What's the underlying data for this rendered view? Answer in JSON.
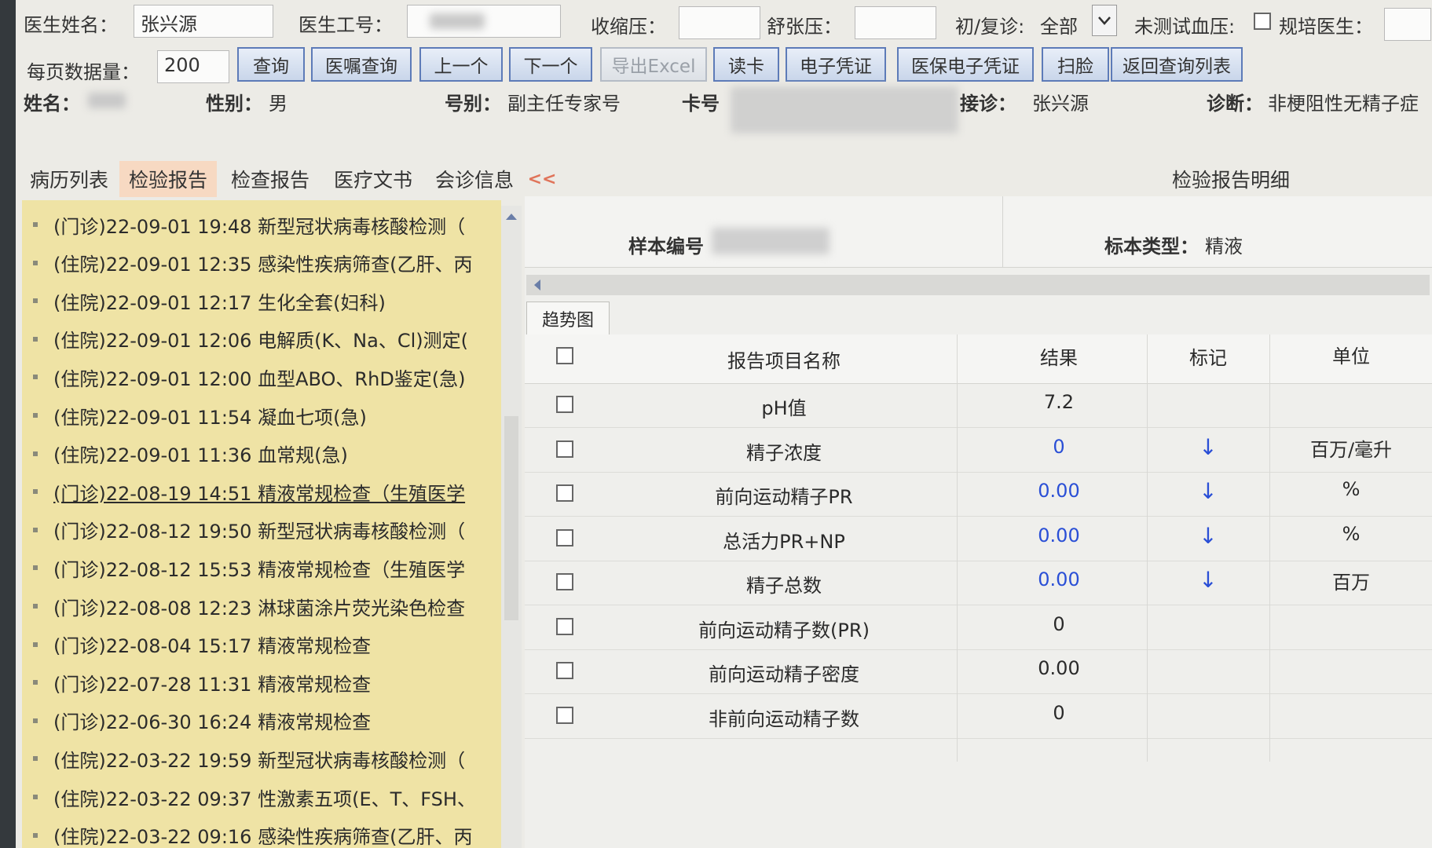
{
  "filters": {
    "doctor_name_label": "医生姓名：",
    "doctor_name_value": "张兴源",
    "doctor_id_label": "医生工号：",
    "systolic_label": "收缩压：",
    "diastolic_label": "舒张压：",
    "visit_type_label": "初/复诊:",
    "visit_type_value": "全部",
    "untested_bp_label": "未测试血压:",
    "resident_doctor_label": "规培医生：",
    "page_size_label": "每页数据量：",
    "page_size_value": "200"
  },
  "toolbar": {
    "query": "查询",
    "order_query": "医嘱查询",
    "prev": "上一个",
    "next": "下一个",
    "export_excel": "导出Excel",
    "read_card": "读卡",
    "e_voucher": "电子凭证",
    "insurance_e_voucher": "医保电子凭证",
    "scan": "扫脸",
    "back_to_list": "返回查询列表"
  },
  "patient": {
    "name_label": "姓名：",
    "gender_label": "性别：",
    "gender_value": "男",
    "reg_type_label": "号别：",
    "reg_type_value": "副主任专家号",
    "card_label": "卡号",
    "doctor_label": "接诊：",
    "doctor_value": "张兴源",
    "diagnosis_label": "诊断：",
    "diagnosis_value": "非梗阻性无精子症"
  },
  "tabs": [
    {
      "label": "病历列表"
    },
    {
      "label": "检验报告"
    },
    {
      "label": "检查报告"
    },
    {
      "label": "医疗文书"
    },
    {
      "label": "会诊信息"
    }
  ],
  "collapse_label": "<<",
  "panel_title": "检验报告明细",
  "reports": [
    "(门诊)22-09-01 19:48 新型冠状病毒核酸检测（",
    "(住院)22-09-01 12:35 感染性疾病筛查(乙肝、丙",
    "(住院)22-09-01 12:17 生化全套(妇科)",
    "(住院)22-09-01 12:06 电解质(K、Na、Cl)测定(",
    "(住院)22-09-01 12:00 血型ABO、RhD鉴定(急)",
    "(住院)22-09-01 11:54 凝血七项(急)",
    "(住院)22-09-01 11:36 血常规(急)",
    "(门诊)22-08-19 14:51 精液常规检查（生殖医学",
    "(门诊)22-08-12 19:50 新型冠状病毒核酸检测（",
    "(门诊)22-08-12 15:53 精液常规检查（生殖医学",
    "(门诊)22-08-08 12:23 淋球菌涂片荧光染色检查",
    "(门诊)22-08-04 15:17 精液常规检查",
    "(门诊)22-07-28 11:31 精液常规检查",
    "(门诊)22-06-30 16:24 精液常规检查",
    "(住院)22-03-22 19:59 新型冠状病毒核酸检测（",
    "(住院)22-03-22 09:37 性激素五项(E、T、FSH、",
    "(住院)22-03-22 09:16 感染性疾病筛查(乙肝、丙"
  ],
  "detail": {
    "sample_no_label": "样本编号",
    "sample_type_label": "标本类型：",
    "sample_type_value": "精液",
    "trend_tab": "趋势图",
    "columns": {
      "name": "报告项目名称",
      "result": "结果",
      "flag": "标记",
      "unit": "单位"
    },
    "rows": [
      {
        "name": "pH值",
        "result": "7.2",
        "flag": "",
        "unit": ""
      },
      {
        "name": "精子浓度",
        "result": "0",
        "flag": "↓",
        "unit": "百万/毫升"
      },
      {
        "name": "前向运动精子PR",
        "result": "0.00",
        "flag": "↓",
        "unit": "%"
      },
      {
        "name": "总活力PR+NP",
        "result": "0.00",
        "flag": "↓",
        "unit": "%"
      },
      {
        "name": "精子总数",
        "result": "0.00",
        "flag": "↓",
        "unit": "百万"
      },
      {
        "name": "前向运动精子数(PR)",
        "result": "0",
        "flag": "",
        "unit": ""
      },
      {
        "name": "前向运动精子密度",
        "result": "0.00",
        "flag": "",
        "unit": ""
      },
      {
        "name": "非前向运动精子数",
        "result": "0",
        "flag": "",
        "unit": ""
      }
    ]
  },
  "colors": {
    "abnormal": "#2a4fd6",
    "list_bg": "#efe3a5",
    "active_tab": "#f7d9c2"
  }
}
